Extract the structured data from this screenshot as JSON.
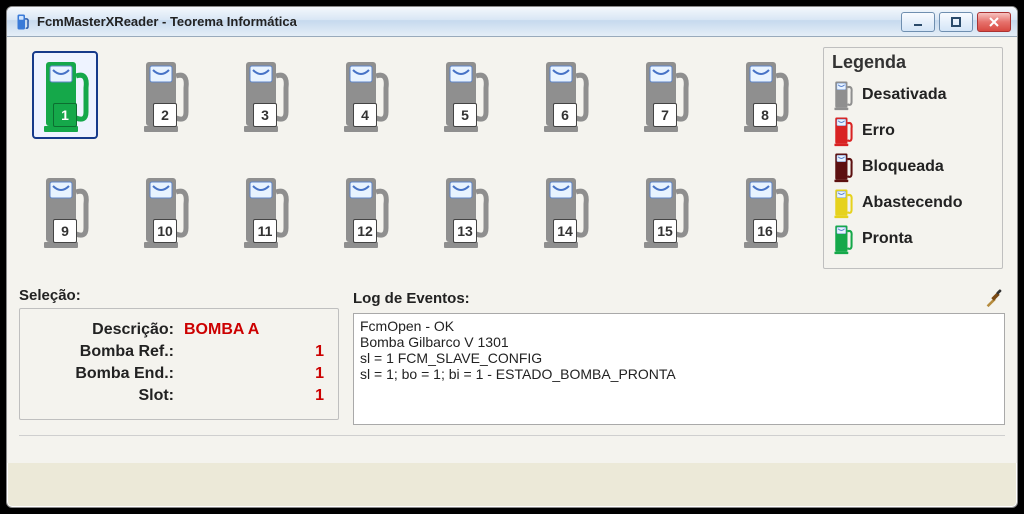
{
  "window": {
    "title": "FcmMasterXReader - Teorema Informática"
  },
  "pumps": [
    {
      "num": "1",
      "state": "pronta",
      "selected": true
    },
    {
      "num": "2",
      "state": "desativada",
      "selected": false
    },
    {
      "num": "3",
      "state": "desativada",
      "selected": false
    },
    {
      "num": "4",
      "state": "desativada",
      "selected": false
    },
    {
      "num": "5",
      "state": "desativada",
      "selected": false
    },
    {
      "num": "6",
      "state": "desativada",
      "selected": false
    },
    {
      "num": "7",
      "state": "desativada",
      "selected": false
    },
    {
      "num": "8",
      "state": "desativada",
      "selected": false
    },
    {
      "num": "9",
      "state": "desativada",
      "selected": false
    },
    {
      "num": "10",
      "state": "desativada",
      "selected": false
    },
    {
      "num": "11",
      "state": "desativada",
      "selected": false
    },
    {
      "num": "12",
      "state": "desativada",
      "selected": false
    },
    {
      "num": "13",
      "state": "desativada",
      "selected": false
    },
    {
      "num": "14",
      "state": "desativada",
      "selected": false
    },
    {
      "num": "15",
      "state": "desativada",
      "selected": false
    },
    {
      "num": "16",
      "state": "desativada",
      "selected": false
    }
  ],
  "legend": {
    "title": "Legenda",
    "items": [
      {
        "label": "Desativada",
        "state": "desativada"
      },
      {
        "label": "Erro",
        "state": "erro"
      },
      {
        "label": "Bloqueada",
        "state": "bloqueada"
      },
      {
        "label": "Abastecendo",
        "state": "abastecendo"
      },
      {
        "label": "Pronta",
        "state": "pronta"
      }
    ]
  },
  "selection": {
    "title": "Seleção:",
    "desc_label": "Descrição:",
    "desc_value": "BOMBA A",
    "ref_label": "Bomba Ref.:",
    "ref_value": "1",
    "end_label": "Bomba End.:",
    "end_value": "1",
    "slot_label": "Slot:",
    "slot_value": "1"
  },
  "log": {
    "title": "Log de Eventos:",
    "clear_icon": "brush-icon",
    "lines": [
      "FcmOpen - OK",
      "Bomba Gilbarco V 1301",
      "sl = 1 FCM_SLAVE_CONFIG",
      "sl = 1; bo = 1; bi = 1 - ESTADO_BOMBA_PRONTA"
    ]
  },
  "colors": {
    "pronta": "#15a84a",
    "desativada": "#8f8f8f",
    "erro": "#d92323",
    "bloqueada": "#5c1010",
    "abastecendo": "#e6d21d"
  }
}
